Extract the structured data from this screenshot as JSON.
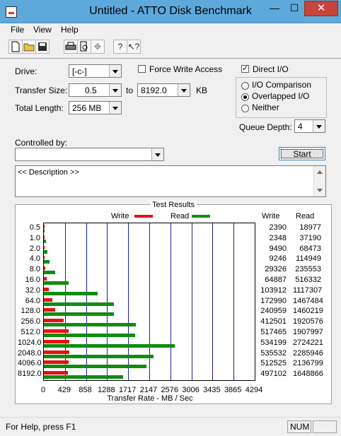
{
  "window": {
    "title": "Untitled - ATTO Disk Benchmark"
  },
  "titlebar_controls": {
    "minimize": "—",
    "maximize": "☐",
    "close": "✕"
  },
  "menu": [
    "File",
    "View",
    "Help"
  ],
  "toolbar": {
    "icons": [
      "new-document-icon",
      "open-folder-icon",
      "save-icon",
      "print-icon",
      "print-preview-icon",
      "move-icon",
      "help-icon",
      "context-help-icon"
    ]
  },
  "settings": {
    "drive_label": "Drive:",
    "drive_value": "[-c-]",
    "force_write_label": "Force Write Access",
    "force_write_checked": false,
    "direct_io_label": "Direct I/O",
    "direct_io_checked": true,
    "transfer_size_label": "Transfer Size:",
    "transfer_from": "0.5",
    "to_label": "to",
    "transfer_to": "8192.0",
    "kb_label": "KB",
    "total_length_label": "Total Length:",
    "total_length_value": "256 MB",
    "io_options": [
      "I/O Comparison",
      "Overlapped I/O",
      "Neither"
    ],
    "io_selected": "Overlapped I/O",
    "queue_depth_label": "Queue Depth:",
    "queue_depth_value": "4",
    "controlled_by_label": "Controlled by:",
    "controlled_by_value": "",
    "start_label": "Start",
    "description": "<< Description >>"
  },
  "results": {
    "title": "Test Results",
    "legend_write": "Write",
    "legend_read": "Read",
    "write_color": "#e31212",
    "read_color": "#118c11",
    "col_write": "Write",
    "col_read": "Read",
    "xlabel": "Transfer Rate - MB / Sec"
  },
  "chart_data": {
    "type": "bar",
    "orientation": "horizontal",
    "categories": [
      "0.5",
      "1.0",
      "2.0",
      "4.0",
      "8.0",
      "16.0",
      "32.0",
      "64.0",
      "128.0",
      "256.0",
      "512.0",
      "1024.0",
      "2048.0",
      "4096.0",
      "8192.0"
    ],
    "series": [
      {
        "name": "Write",
        "values": [
          2390,
          2348,
          9490,
          9246,
          29326,
          64887,
          103912,
          172990,
          240959,
          412501,
          517465,
          534199,
          535532,
          512525,
          497102
        ]
      },
      {
        "name": "Read",
        "values": [
          18977,
          37190,
          68473,
          114949,
          235553,
          516332,
          1117307,
          1467484,
          1460219,
          1920576,
          1907997,
          2724221,
          2285946,
          2136799,
          1648866
        ]
      }
    ],
    "xticks": [
      "0",
      "429",
      "858",
      "1288",
      "1717",
      "2147",
      "2576",
      "3006",
      "3435",
      "3865",
      "4294"
    ],
    "xlabel": "Transfer Rate - MB / Sec",
    "xlim": [
      0,
      4294
    ]
  },
  "status": {
    "help_text": "For Help, press F1",
    "num": "NUM"
  }
}
